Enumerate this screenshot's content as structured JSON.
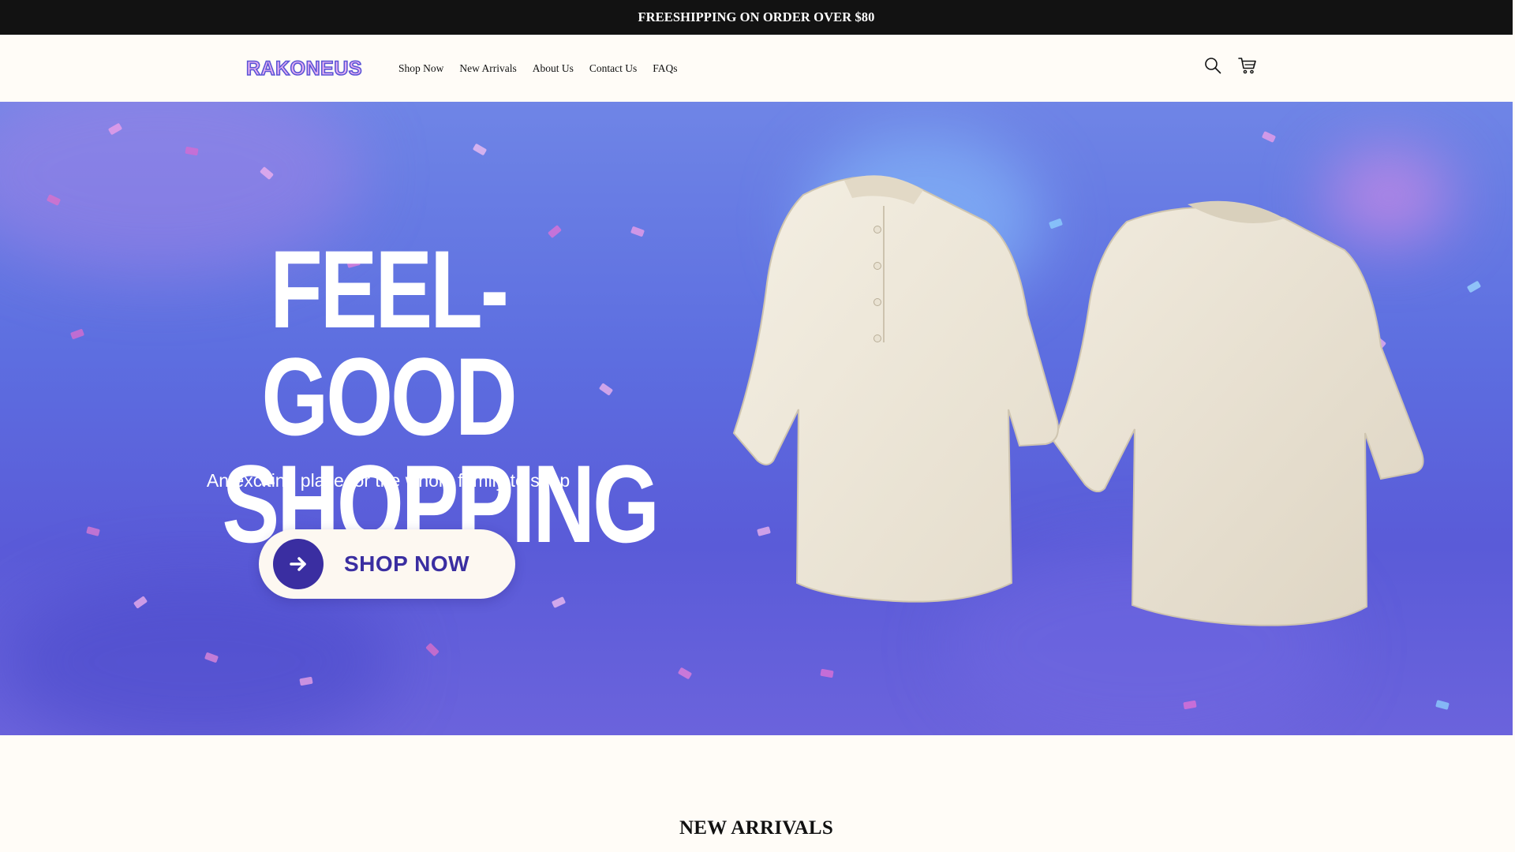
{
  "announcement": {
    "text": "FREESHIPPING ON ORDER OVER $80"
  },
  "header": {
    "logo_text": "RAKONEUS",
    "nav": [
      "Shop Now",
      "New Arrivals",
      "About Us",
      "Contact Us",
      "FAQs"
    ],
    "icons": [
      "search-icon",
      "cart-icon"
    ]
  },
  "hero": {
    "title_line1": "FEEL-GOOD",
    "title_line2": "SHOPPING",
    "subtitle": "An exciting place for the whole family to shop",
    "button_label": "SHOP NOW",
    "colors": {
      "accent": "#3a2ea1",
      "background": "#5f6ddf",
      "shirt": "#ebe5d6"
    }
  },
  "section": {
    "title": "NEW ARRIVALS"
  }
}
